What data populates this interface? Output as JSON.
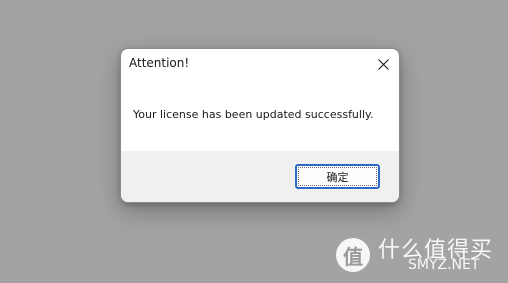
{
  "dialog": {
    "title": "Attention!",
    "message": "Your license has been updated successfully.",
    "ok_label": "确定",
    "close_icon": "close-icon"
  },
  "watermark": {
    "logo_glyph": "值",
    "cn_text": "什么值得买",
    "en_text": "SMYZ.NET"
  },
  "colors": {
    "backdrop": "#a3a3a3",
    "dialog_bg": "#ffffff",
    "footer_bg": "#f0f0f0",
    "button_focus_border": "#2f68c8"
  }
}
